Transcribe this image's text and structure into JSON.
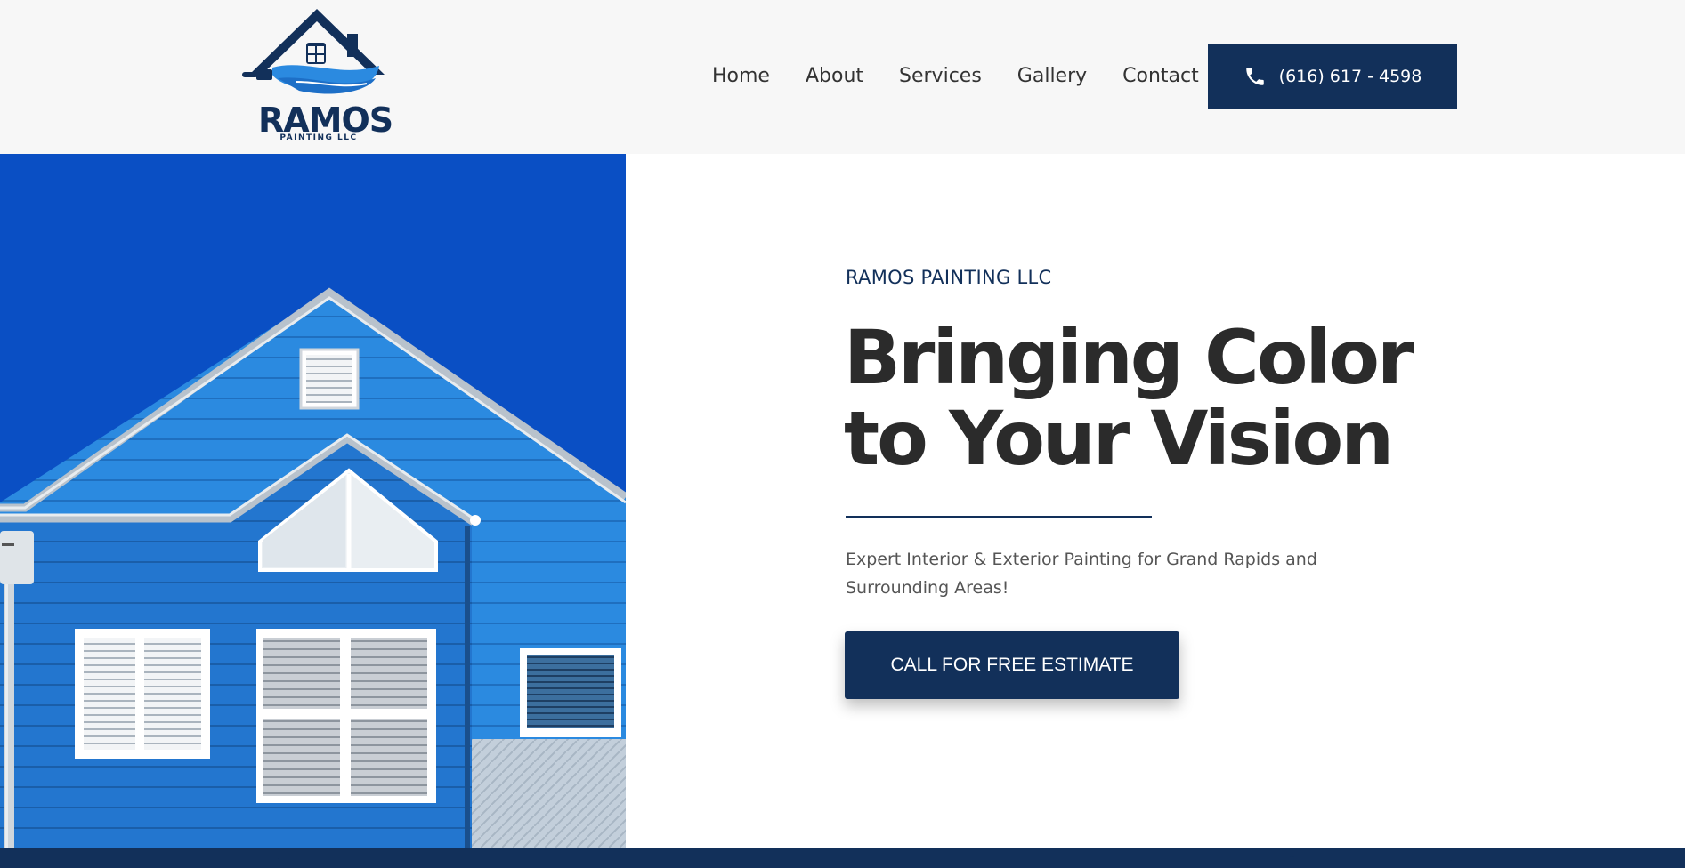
{
  "header": {
    "logo": {
      "name": "RAMOS",
      "tagline": "PAINTING LLC"
    },
    "nav": [
      {
        "label": "Home"
      },
      {
        "label": "About"
      },
      {
        "label": "Services"
      },
      {
        "label": "Gallery"
      },
      {
        "label": "Contact"
      }
    ],
    "phone_button": {
      "label": "(616) 617 - 4598",
      "icon": "phone-icon"
    }
  },
  "hero": {
    "eyebrow": "RAMOS PAINTING LLC",
    "headline_line1": "Bringing Color",
    "headline_line2": "to Your Vision",
    "subtext": "Expert Interior & Exterior Painting for Grand Rapids and Surrounding Areas!",
    "cta_label": "CALL FOR FREE ESTIMATE",
    "image": "blue-house-photo"
  },
  "colors": {
    "brand_navy": "#12305a",
    "header_bg": "#f7f7f7",
    "sky_blue": "#0a4fc4",
    "siding_blue": "#2b8ae0",
    "text_dark": "#2b2b2b"
  }
}
